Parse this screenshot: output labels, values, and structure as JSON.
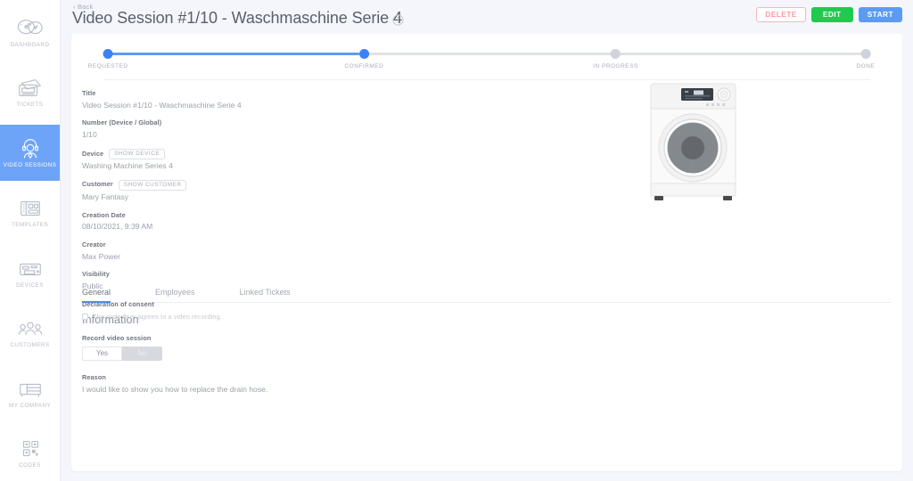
{
  "sidebar": {
    "items": [
      {
        "label": "DASHBOARD",
        "icon": "dashboard-gauge-icon",
        "active": false
      },
      {
        "label": "TICKETS",
        "icon": "tickets-icon",
        "active": false
      },
      {
        "label": "VIDEO SESSIONS",
        "icon": "headset-agent-icon",
        "active": true
      },
      {
        "label": "TEMPLATES",
        "icon": "templates-grid-icon",
        "active": false
      },
      {
        "label": "DEVICES",
        "icon": "device-printer-icon",
        "active": false
      },
      {
        "label": "CUSTOMERS",
        "icon": "customers-group-icon",
        "active": false
      },
      {
        "label": "MY COMPANY",
        "icon": "company-desk-icon",
        "active": false
      },
      {
        "label": "CODES",
        "icon": "codes-qr-icon",
        "active": false
      }
    ]
  },
  "header": {
    "back_label": "‹ Back",
    "title": "Video Session #1/10 - Waschmaschine Serie 4",
    "info_icon": "info-circle-icon",
    "buttons": {
      "delete": "DELETE",
      "edit": "EDIT",
      "start": "START"
    },
    "colors": {
      "delete_border": "#f7b6bd",
      "delete_text": "#f59aa3",
      "edit_bg": "#1ecb4f",
      "start_bg": "#5b9bf5"
    }
  },
  "stepper": {
    "steps": [
      {
        "label": "REQUESTED",
        "state": "done"
      },
      {
        "label": "CONFIRMED",
        "state": "done"
      },
      {
        "label": "IN PROGRESS",
        "state": "pending"
      },
      {
        "label": "DONE",
        "state": "pending"
      }
    ],
    "active_color": "#3b82f6",
    "inactive_color": "#cfd3db"
  },
  "details": {
    "title": {
      "label": "Title",
      "value": "Video Session #1/10 - Waschmaschine Serie 4"
    },
    "number": {
      "label": "Number (Device / Global)",
      "value": "1/10"
    },
    "device": {
      "label": "Device",
      "chip": "SHOW DEVICE",
      "value": "Washing Machine Series 4"
    },
    "customer": {
      "label": "Customer",
      "chip": "SHOW CUSTOMER",
      "value": "Mary Fantasy"
    },
    "creation_date": {
      "label": "Creation Date",
      "value": "08/10/2021, 9:39 AM"
    },
    "creator": {
      "label": "Creator",
      "value": "Max Power"
    },
    "visibility": {
      "label": "Visibility",
      "value": "Public"
    },
    "consent": {
      "label": "Declaration of consent",
      "checkbox_text": "The code user agrees to a video recording.",
      "checked": false
    },
    "device_image_alt": "washing-machine-front-loader"
  },
  "tabs": [
    {
      "label": "General",
      "active": true
    },
    {
      "label": "Employees",
      "active": false
    },
    {
      "label": "Linked Tickets",
      "active": false
    }
  ],
  "information": {
    "section_title": "Information",
    "record": {
      "label": "Record video session",
      "yes": "Yes",
      "no": "No",
      "selected": "Yes"
    },
    "reason": {
      "label": "Reason",
      "value": "I would like to show you how to replace the drain hose."
    }
  }
}
